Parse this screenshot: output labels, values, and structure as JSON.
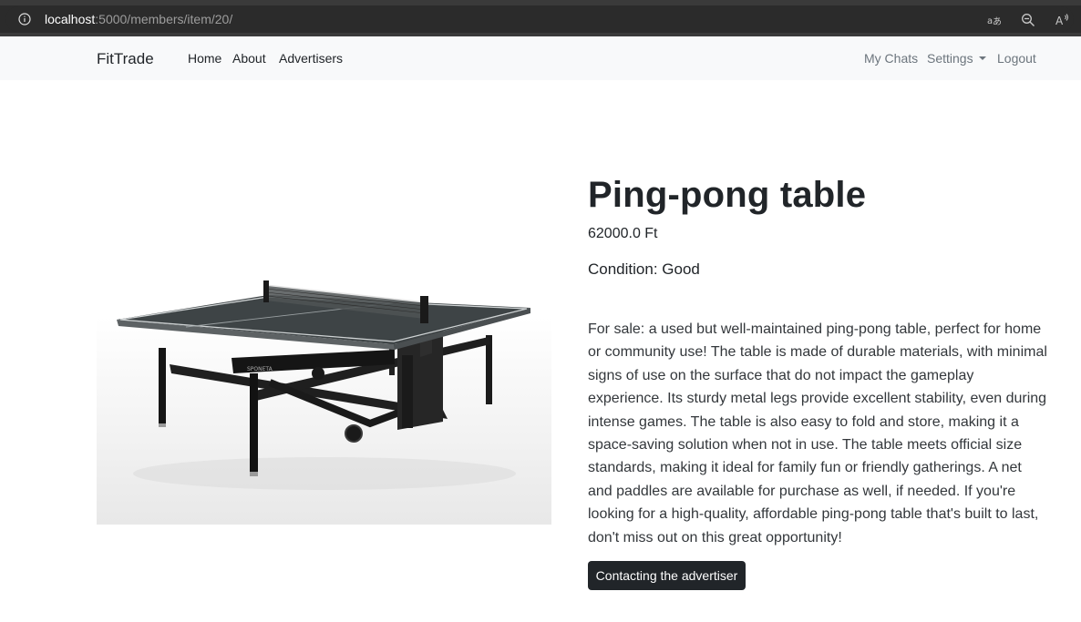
{
  "browser": {
    "url_host": "localhost",
    "url_path": ":5000/members/item/20/"
  },
  "navbar": {
    "brand": "FitTrade",
    "left_links": [
      "Home",
      "About",
      "Advertisers"
    ],
    "right_links": [
      "My Chats",
      "Settings",
      "Logout"
    ]
  },
  "product": {
    "title": "Ping-pong table",
    "price": "62000.0 Ft",
    "condition": "Condition: Good",
    "description": "For sale: a used but well-maintained ping-pong table, perfect for home or community use! The table is made of durable materials, with minimal signs of use on the surface that do not impact the gameplay experience. Its sturdy metal legs provide excellent stability, even during intense games. The table is also easy to fold and store, making it a space-saving solution when not in use. The table meets official size standards, making it ideal for family fun or friendly gatherings. A net and paddles are available for purchase as well, if needed. If you're looking for a high-quality, affordable ping-pong table that's built to last, don't miss out on this great opportunity!",
    "contact_button": "Contacting the advertiser",
    "image_icon": "ping-pong-table-image",
    "image_brand_text": "SPONETA"
  },
  "colors": {
    "navbar_bg": "#f8f9fa",
    "button_bg": "#212529",
    "text": "#212529",
    "muted": "#6c757d"
  }
}
